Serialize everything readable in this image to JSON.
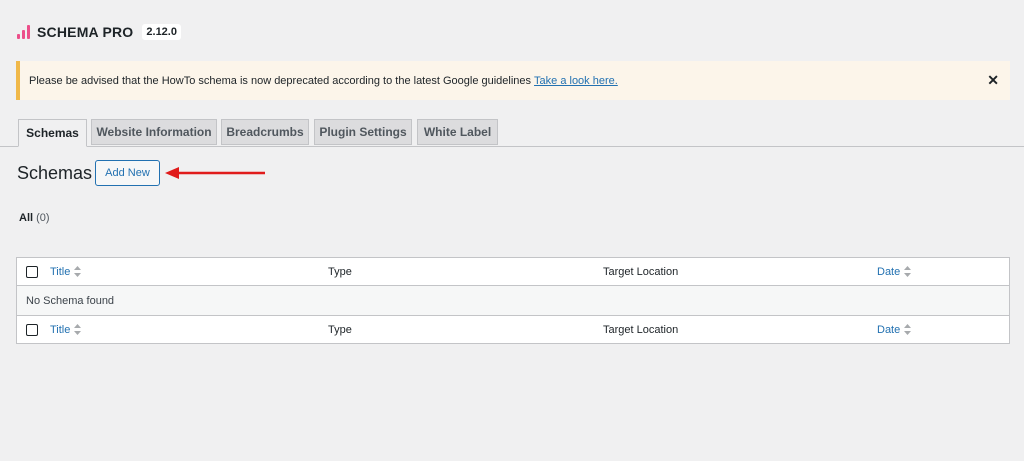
{
  "brand": {
    "name": "SCHEMA PRO",
    "version": "2.12.0",
    "accent_color": "#ec4e8a"
  },
  "notice": {
    "text": "Please be advised that the HowTo schema is now deprecated according to the latest Google guidelines",
    "link_text": "Take a look here.",
    "close_glyph": "✕",
    "accent_color": "#f0b849"
  },
  "tabs": [
    {
      "label": "Schemas",
      "active": true
    },
    {
      "label": "Website Information",
      "active": false
    },
    {
      "label": "Breadcrumbs",
      "active": false
    },
    {
      "label": "Plugin Settings",
      "active": false
    },
    {
      "label": "White Label",
      "active": false
    }
  ],
  "page": {
    "title": "Schemas",
    "add_new_label": "Add New"
  },
  "filter": {
    "label": "All",
    "count": "(0)"
  },
  "table": {
    "columns": {
      "title": "Title",
      "type": "Type",
      "target": "Target Location",
      "date": "Date"
    },
    "empty_message": "No Schema found"
  },
  "colors": {
    "link": "#2271b1",
    "annotation_arrow": "#e01b1b"
  }
}
